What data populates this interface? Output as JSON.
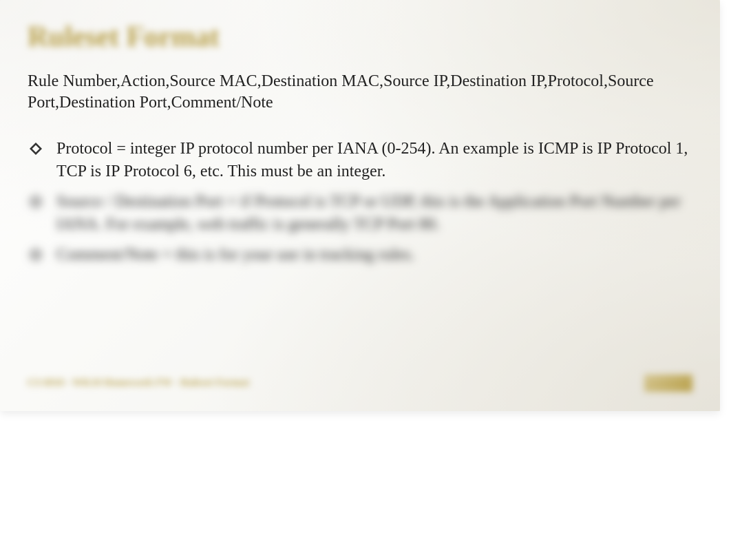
{
  "title": "Ruleset Format",
  "format_line": "Rule  Number,Action,Source MAC,Destination MAC,Source IP,Destination IP,Protocol,Source        Port,Destination Port,Comment/Note",
  "bullets": [
    {
      "text": "Protocol = integer IP protocol number per IANA (0-254). An example is ICMP is IP Protocol 1, TCP is IP Protocol 6, etc. This must be an integer.",
      "blurred": false
    },
    {
      "text": "Source / Destination Port = if Protocol is TCP or UDP, this is the Application Port Number per IANA. For example, web traffic is generally TCP Port 80.",
      "blurred": true
    },
    {
      "text": "Comment/Note = this is for your use in tracking rules.",
      "blurred": true
    }
  ],
  "footer": "CS 6910 - WK10 Homework FW - Ruleset Format"
}
